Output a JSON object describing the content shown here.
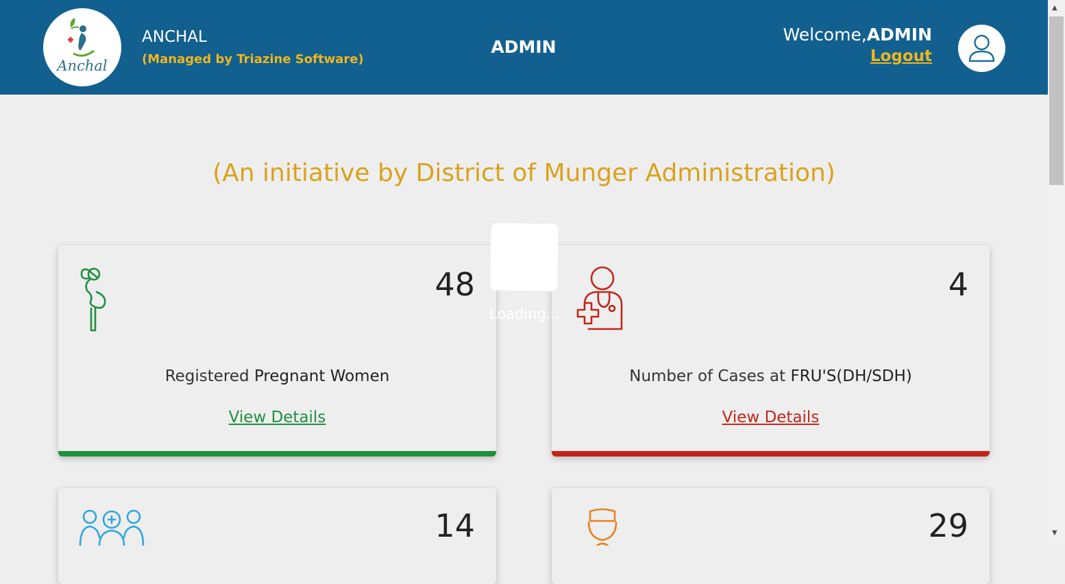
{
  "header": {
    "logo_word": "Anchal",
    "brand_name": "ANCHAL",
    "brand_sub": "(Managed by Triazine Software)",
    "center_title": "ADMIN",
    "welcome_prefix": "Welcome,",
    "username": "ADMIN",
    "logout_label": "Logout"
  },
  "banner": {
    "initiative": "(An initiative by District of Munger Administration)"
  },
  "loading": {
    "text": "Loading..."
  },
  "cards": [
    {
      "value": "48",
      "label_normal": "Registered ",
      "label_strong": "Pregnant Women",
      "link": "View Details",
      "accent": "#1e8f3f",
      "icon": "pregnant-woman-icon"
    },
    {
      "value": "4",
      "label_normal": "Number of Cases at ",
      "label_strong": "FRU'S(DH/SDH)",
      "link": "View Details",
      "accent": "#c0271a",
      "icon": "doctor-cross-icon"
    },
    {
      "value": "14",
      "label_normal": "",
      "label_strong": "",
      "link": "",
      "accent": "#2ea6dc",
      "icon": "medical-team-icon"
    },
    {
      "value": "29",
      "label_normal": "",
      "label_strong": "",
      "link": "",
      "accent": "#e8801f",
      "icon": "nurse-icon"
    }
  ],
  "colors": {
    "header_bg": "#12608f",
    "gold": "#f0b51d",
    "initiative": "#d9a21c",
    "page_bg": "#eeeeee"
  }
}
